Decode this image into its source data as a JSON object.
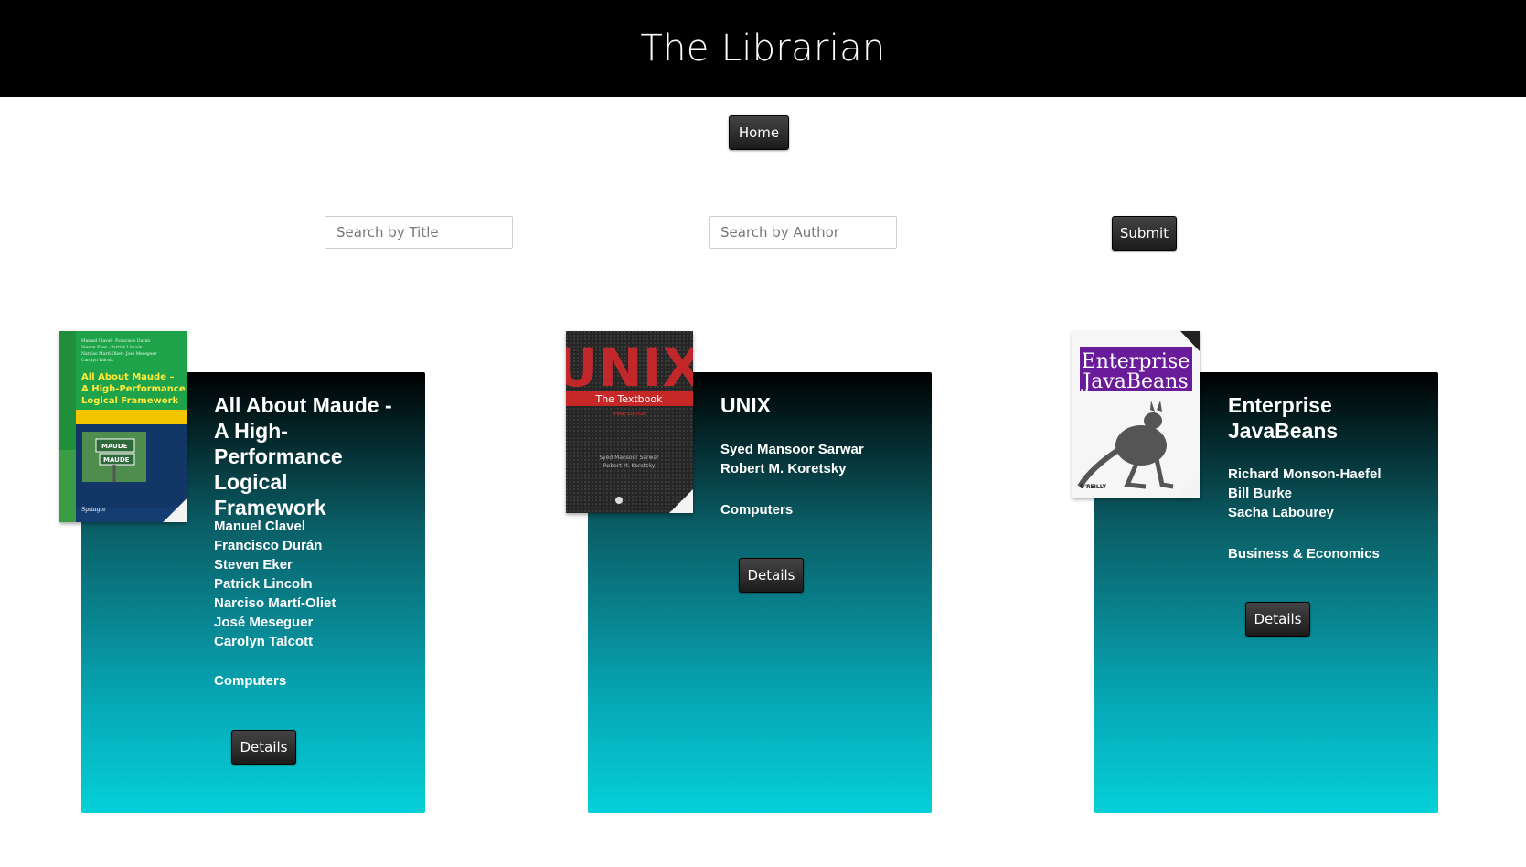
{
  "header": {
    "title": "The Librarian"
  },
  "nav": {
    "home_label": "Home"
  },
  "search": {
    "title_placeholder": "Search by Title",
    "author_placeholder": "Search by Author",
    "submit_label": "Submit"
  },
  "books": [
    {
      "title": "All About Maude - A High-Performance Logical Framework",
      "authors": [
        "Manuel Clavel",
        "Francisco Durán",
        "Steven Eker",
        "Patrick Lincoln",
        "Narciso Martí-Oliet",
        "José Meseguer",
        "Carolyn Talcott"
      ],
      "category": "Computers",
      "details_label": "Details",
      "cover": {
        "publisher": "Springer",
        "title_lines": [
          "All About Maude –",
          "A High-Performance",
          "Logical Framework"
        ],
        "sign_lines": [
          "MAUDE",
          "MAUDE"
        ]
      }
    },
    {
      "title": "UNIX",
      "authors": [
        "Syed Mansoor Sarwar",
        "Robert M. Koretsky"
      ],
      "category": "Computers",
      "details_label": "Details",
      "cover": {
        "big_text": "UNIX",
        "subtitle": "The Textbook",
        "edition": "THIRD EDITION",
        "author_lines": [
          "Syed Mansoor Sarwar",
          "Robert M. Koretsky"
        ]
      }
    },
    {
      "title": "Enterprise JavaBeans",
      "authors": [
        "Richard Monson-Haefel",
        "Bill Burke",
        "Sacha Labourey"
      ],
      "category": "Business & Economics",
      "details_label": "Details",
      "cover": {
        "title_lines": [
          "Enterprise",
          "JavaBeans"
        ],
        "publisher": "O'REILLY"
      }
    }
  ]
}
